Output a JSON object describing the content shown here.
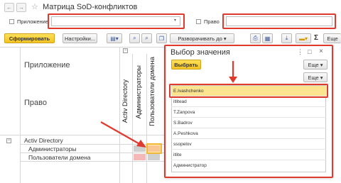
{
  "window": {
    "title": "Матрица SoD-конфликтов",
    "star": "☆",
    "back": "←",
    "forward": "→"
  },
  "filters": {
    "app_label": "Приложение",
    "app_value": "",
    "right_label": "Право",
    "right_value": ""
  },
  "toolbar": {
    "generate": "Сформировать",
    "settings": "Настройки...",
    "expand": "Разворачивать до",
    "more": "Еще"
  },
  "report": {
    "col_header_app": "Приложение",
    "col_header_right": "Право",
    "columns": [
      "Activ Directory",
      "Администраторы",
      "Пользователи домена"
    ],
    "rows": [
      {
        "label": "Activ Directory",
        "level": 0
      },
      {
        "label": "Администраторы",
        "level": 1
      },
      {
        "label": "Пользователи домена",
        "level": 1
      }
    ]
  },
  "dialog": {
    "title": "Выбор значения",
    "select": "Выбрать",
    "more1": "Еще",
    "more2": "Еще",
    "items": [
      "E.Ivashchenko",
      "itlitead",
      "T.Zanpova",
      "S.Badrov",
      "A.Peshkova",
      "ssopelov",
      "itlite",
      "Администратор"
    ],
    "selected_index": 0
  },
  "colors": {
    "highlight": "#e03a2e",
    "primary": "#f2c322",
    "selected_row": "#fbe38f"
  }
}
